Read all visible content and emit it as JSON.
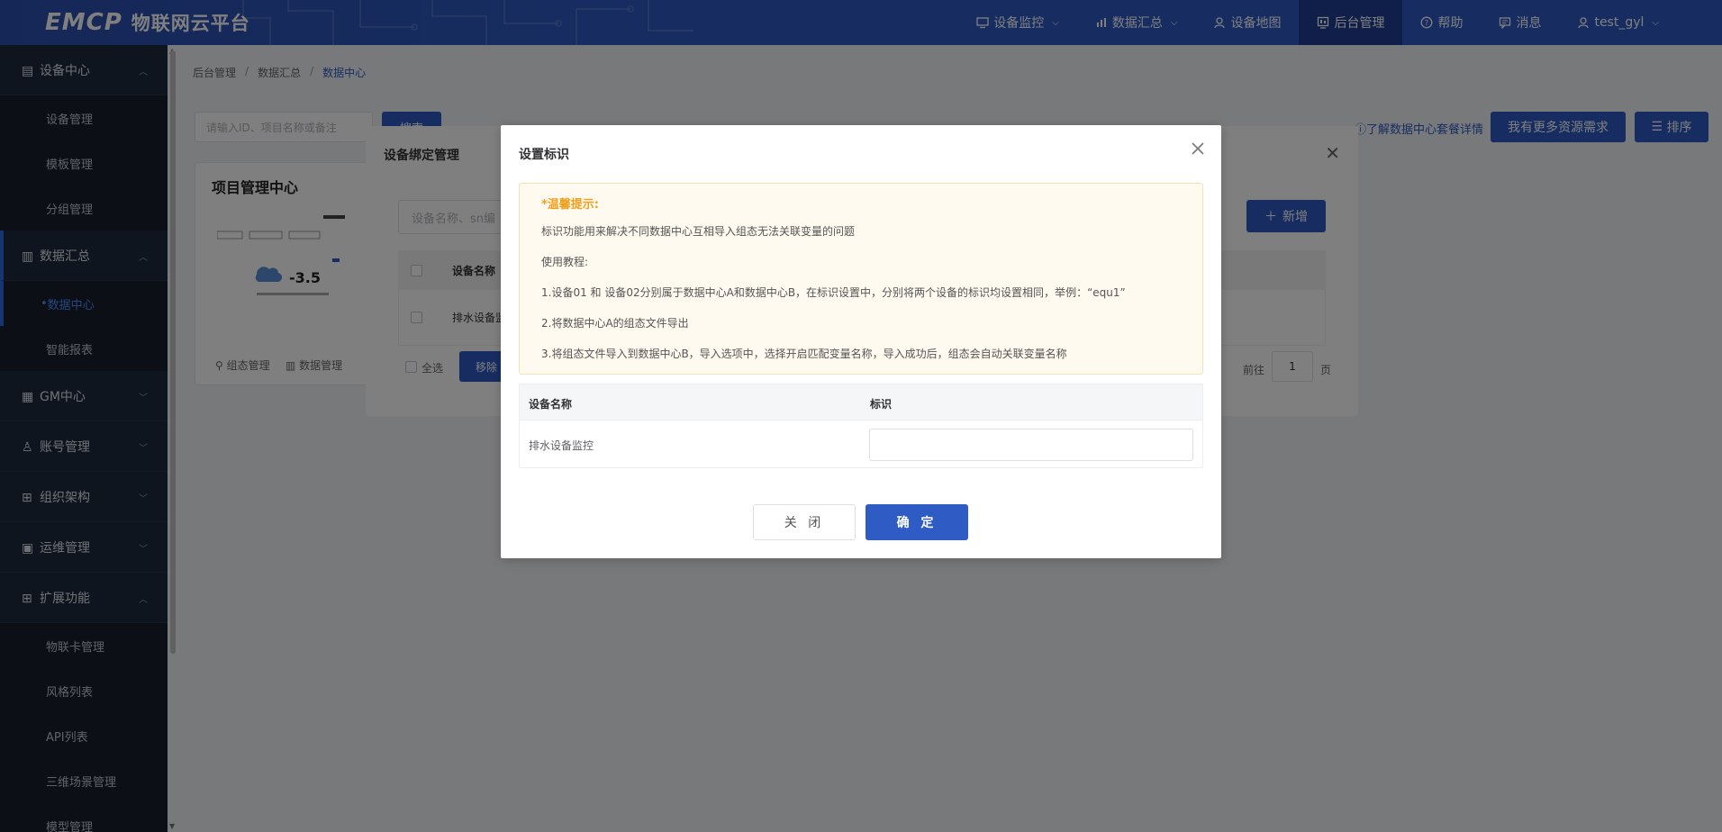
{
  "header": {
    "logo_mark": "EMCP",
    "logo_text": "物联网云平台",
    "nav": [
      {
        "label": "设备监控",
        "icon": "monitor-icon",
        "dropdown": true
      },
      {
        "label": "数据汇总",
        "icon": "chart-icon",
        "dropdown": true
      },
      {
        "label": "设备地图",
        "icon": "map-pin-icon",
        "dropdown": false
      },
      {
        "label": "后台管理",
        "icon": "dashboard-icon",
        "dropdown": false,
        "active": true
      },
      {
        "label": "帮助",
        "icon": "help-icon",
        "dropdown": false
      },
      {
        "label": "消息",
        "icon": "message-icon",
        "dropdown": false
      },
      {
        "label": "test_gyl",
        "icon": "user-icon",
        "dropdown": true
      }
    ]
  },
  "sidebar": {
    "groups": [
      {
        "label": "设备中心",
        "icon": "device-icon",
        "expanded": true,
        "items": [
          "设备管理",
          "模板管理",
          "分组管理"
        ]
      },
      {
        "label": "数据汇总",
        "icon": "chart-icon",
        "expanded": true,
        "items": [
          "数据中心",
          "智能报表"
        ]
      },
      {
        "label": "GM中心",
        "icon": "gm-icon",
        "expanded": false
      },
      {
        "label": "账号管理",
        "icon": "user-icon",
        "expanded": false
      },
      {
        "label": "组织架构",
        "icon": "org-icon",
        "expanded": false
      },
      {
        "label": "运维管理",
        "icon": "ops-icon",
        "expanded": false
      },
      {
        "label": "扩展功能",
        "icon": "grid-icon",
        "expanded": true,
        "items": [
          "物联卡管理",
          "风格列表",
          "API列表",
          "三维场景管理",
          "模型管理"
        ]
      }
    ]
  },
  "breadcrumb": [
    "后台管理",
    "数据汇总",
    "数据中心"
  ],
  "main": {
    "search_placeholder": "请输入ID、项目名称或备注",
    "search_button": "搜索",
    "learn_link": "了解数据中心套餐详情",
    "more_resources_button": "我有更多资源需求",
    "sort_button": "排序",
    "project_card": {
      "title": "项目管理中心",
      "temperature": "-3.5",
      "actions": [
        "组态管理",
        "数据管理"
      ]
    }
  },
  "bind_modal": {
    "title": "设备绑定管理",
    "search_placeholder": "设备名称、sn编",
    "add_button": "新增",
    "column_device_name": "设备名称",
    "row_device_name": "排水设备监",
    "select_all": "全选",
    "remove_button": "移除",
    "goto_label": "前往",
    "page": "1",
    "page_unit": "页"
  },
  "dialog": {
    "title": "设置标识",
    "tips": {
      "heading": "*温馨提示:",
      "lines": [
        "标识功能用来解决不同数据中心互相导入组态无法关联变量的问题",
        "使用教程:",
        "1.设备01 和 设备02分别属于数据中心A和数据中心B，在标识设置中，分别将两个设备的标识均设置相同，举例：“equ1”",
        "2.将数据中心A的组态文件导出",
        "3.将组态文件导入到数据中心B，导入选项中，选择开启匹配变量名称，导入成功后，组态会自动关联变量名称"
      ]
    },
    "table": {
      "headers": [
        "设备名称",
        "标识"
      ],
      "rows": [
        {
          "device_name": "排水设备监控",
          "mark": ""
        }
      ]
    },
    "close_button": "关 闭",
    "confirm_button": "确 定"
  },
  "colors": {
    "primary": "#2f5bc4",
    "sidebar_bg": "#1f2b3d",
    "tip_heading": "#f0a020",
    "tip_bg": "#fffaef"
  }
}
